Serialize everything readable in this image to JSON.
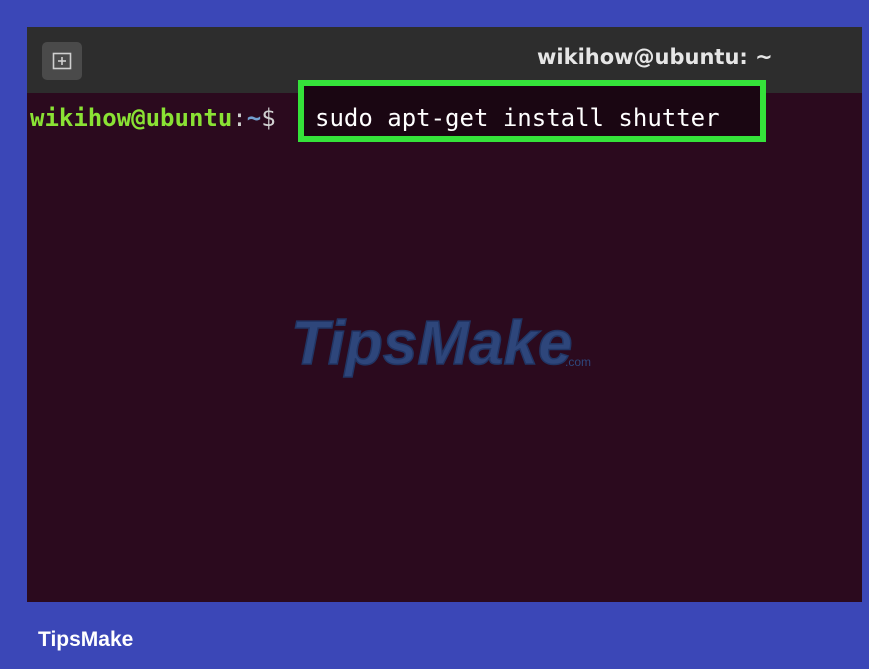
{
  "window": {
    "title": "wikihow@ubuntu: ~"
  },
  "terminal": {
    "prompt_user_host": "wikihow@ubuntu",
    "prompt_colon": ":",
    "prompt_path": "~",
    "prompt_symbol": "$",
    "command": "sudo apt-get install shutter"
  },
  "watermark": {
    "text": "TipsMake",
    "suffix": ".com"
  },
  "footer": {
    "label": "TipsMake"
  },
  "colors": {
    "background": "#3b47b7",
    "terminal_bg": "#2b0a1e",
    "titlebar_bg": "#2d2d2d",
    "highlight_box": "#35e23a",
    "prompt_user": "#8ae234",
    "prompt_path": "#729fcf"
  },
  "icons": {
    "new_tab": "new-tab-icon"
  }
}
